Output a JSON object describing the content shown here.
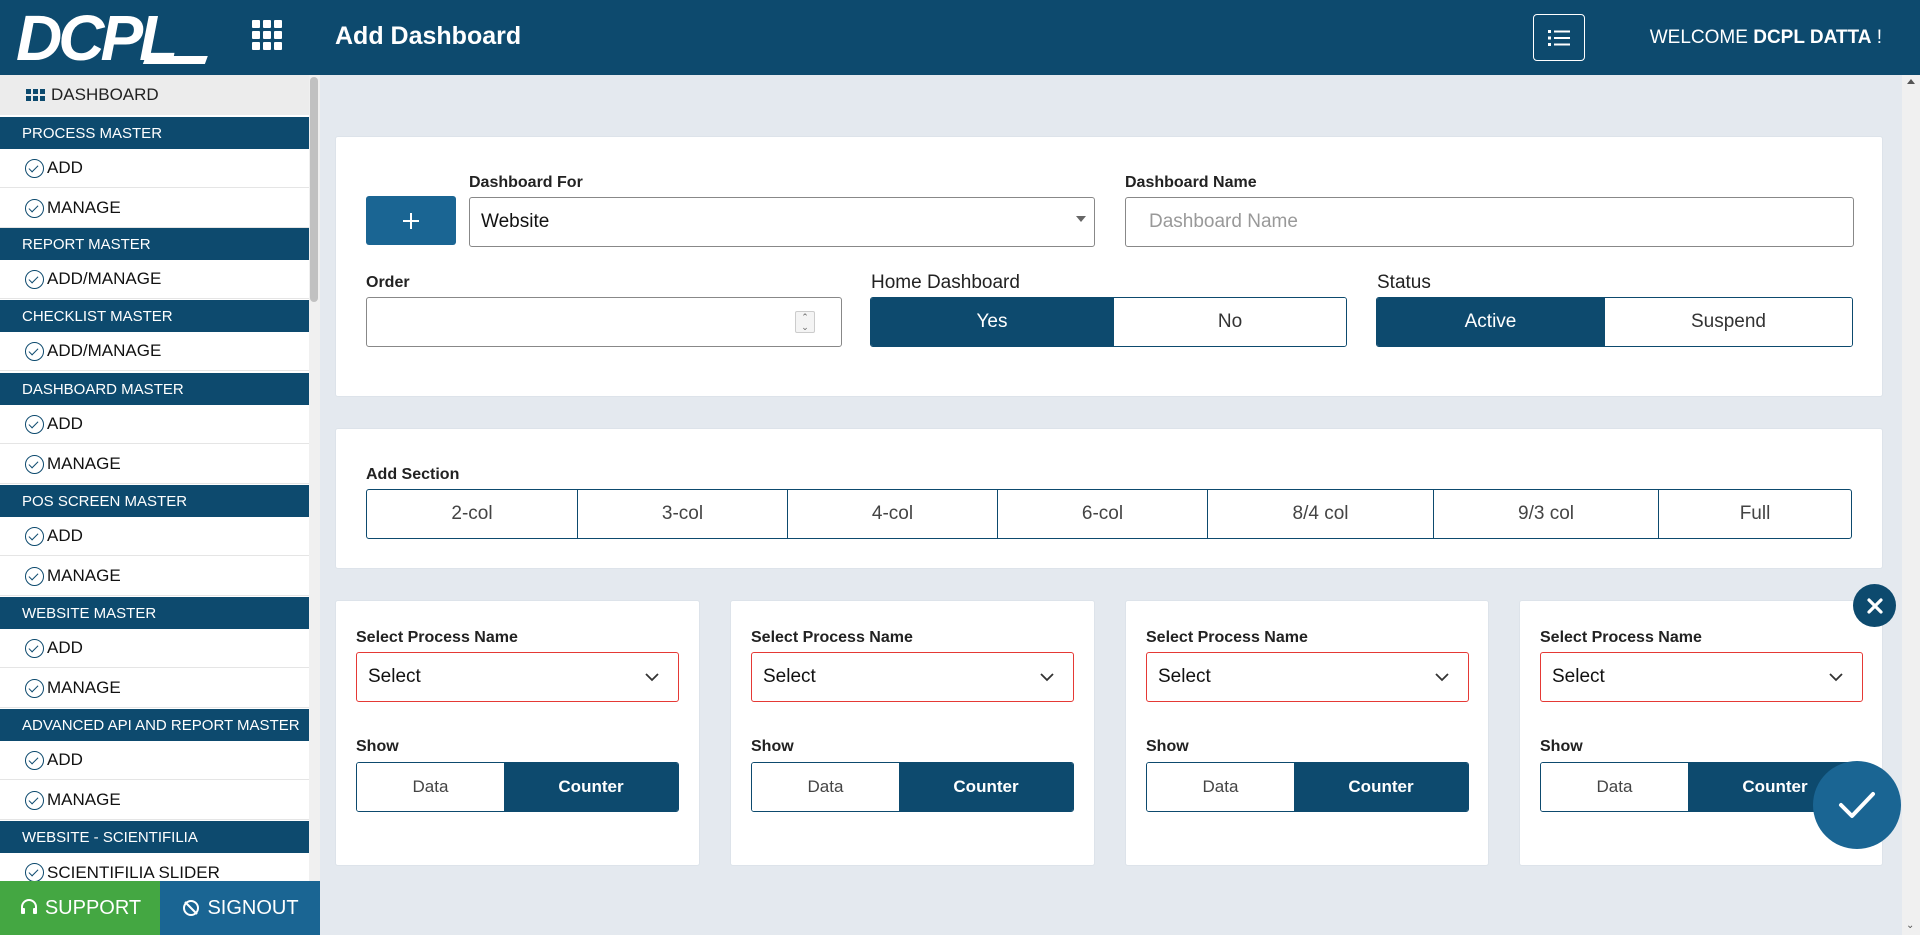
{
  "header": {
    "logo_text": "DCPL",
    "title": "Add Dashboard",
    "welcome_prefix": "WELCOME",
    "welcome_user": "DCPL DATTA",
    "welcome_suffix": "!",
    "colors": {
      "primary": "#0d4a6e",
      "accent": "#1a6593",
      "support": "#44a742",
      "error": "#e53935"
    }
  },
  "sidebar": {
    "dashboard_label": "DASHBOARD",
    "groups": [
      {
        "title": "PROCESS MASTER",
        "items": [
          "ADD",
          "MANAGE"
        ]
      },
      {
        "title": "REPORT MASTER",
        "items": [
          "ADD/MANAGE"
        ]
      },
      {
        "title": "CHECKLIST MASTER",
        "items": [
          "ADD/MANAGE"
        ]
      },
      {
        "title": "DASHBOARD MASTER",
        "items": [
          "ADD",
          "MANAGE"
        ]
      },
      {
        "title": "POS SCREEN MASTER",
        "items": [
          "ADD",
          "MANAGE"
        ]
      },
      {
        "title": "WEBSITE MASTER",
        "items": [
          "ADD",
          "MANAGE"
        ]
      },
      {
        "title": "ADVANCED API AND REPORT MASTER",
        "items": [
          "ADD",
          "MANAGE"
        ]
      },
      {
        "title": "WEBSITE - SCIENTIFILIA",
        "items": [
          "SCIENTIFILIA SLIDER"
        ]
      }
    ],
    "support_label": "SUPPORT",
    "signout_label": "SIGNOUT"
  },
  "form": {
    "dashboard_for_label": "Dashboard For",
    "dashboard_for_value": "Website",
    "dashboard_name_label": "Dashboard Name",
    "dashboard_name_placeholder": "Dashboard Name",
    "order_label": "Order",
    "home_dashboard_label": "Home Dashboard",
    "home_yes": "Yes",
    "home_no": "No",
    "status_label": "Status",
    "status_active": "Active",
    "status_suspend": "Suspend"
  },
  "sections": {
    "label": "Add Section",
    "options": [
      "2-col",
      "3-col",
      "4-col",
      "6-col",
      "8/4 col",
      "9/3 col",
      "Full"
    ]
  },
  "columns": [
    {
      "process_label": "Select Process Name",
      "process_value": "Select",
      "show_label": "Show",
      "data_label": "Data",
      "counter_label": "Counter"
    },
    {
      "process_label": "Select Process Name",
      "process_value": "Select",
      "show_label": "Show",
      "data_label": "Data",
      "counter_label": "Counter"
    },
    {
      "process_label": "Select Process Name",
      "process_value": "Select",
      "show_label": "Show",
      "data_label": "Data",
      "counter_label": "Counter"
    },
    {
      "process_label": "Select Process Name",
      "process_value": "Select",
      "show_label": "Show",
      "data_label": "Data",
      "counter_label": "Counter"
    }
  ]
}
